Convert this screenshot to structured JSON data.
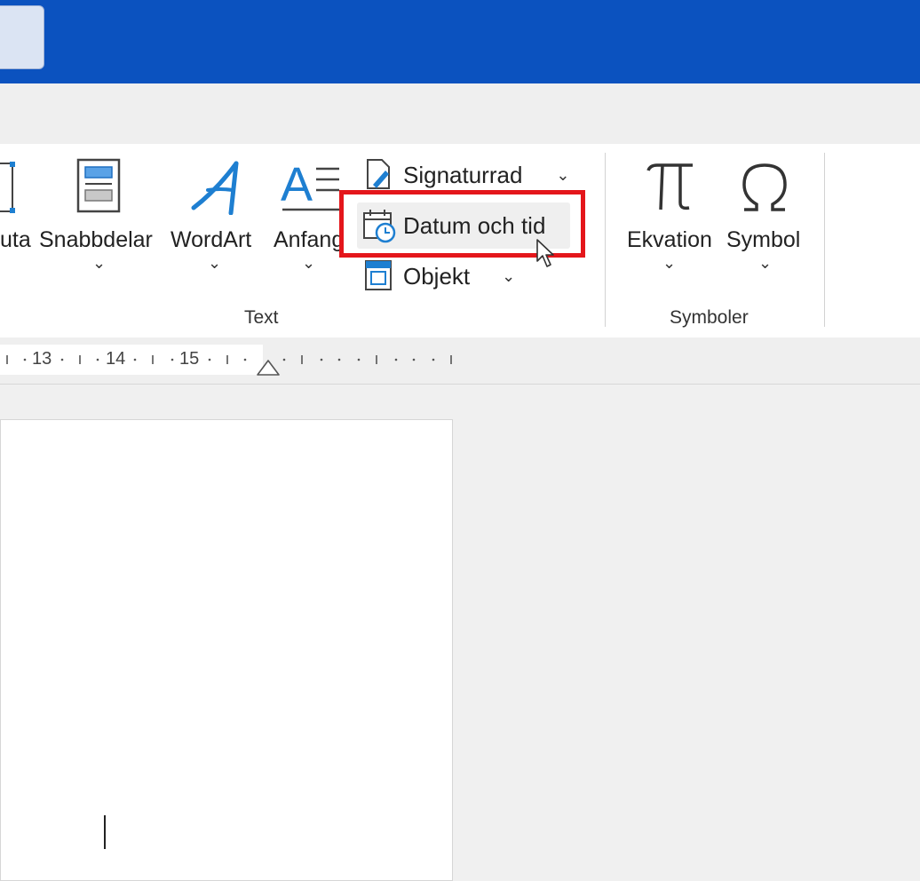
{
  "ribbon": {
    "text_group": {
      "label": "Text",
      "buttons": {
        "textbox_partial": "uta",
        "quick_parts": "Snabbdelar",
        "wordart": "WordArt",
        "dropcap": "Anfang"
      },
      "small_items": {
        "signature_line": "Signaturrad",
        "date_time": "Datum och tid",
        "object": "Objekt"
      }
    },
    "symbols_group": {
      "label": "Symboler",
      "buttons": {
        "equation": "Ekvation",
        "symbol": "Symbol"
      }
    },
    "chevron": "⌄"
  },
  "ruler": {
    "numbers": [
      "13",
      "14",
      "15"
    ]
  },
  "colors": {
    "titlebar": "#0b52bf",
    "highlight_box": "#e4161b",
    "icon_accent": "#1e7fd1"
  }
}
